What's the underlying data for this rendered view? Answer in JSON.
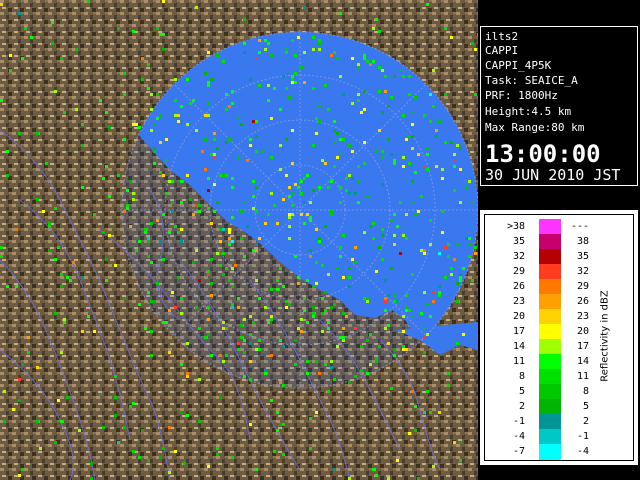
{
  "info": {
    "radar": "ilts2",
    "product": "CAPPI",
    "product_name": "CAPPI_4P5K",
    "task": "Task: SEAICE_A",
    "prf": "PRF: 1800Hz",
    "height": "Height:4.5 km",
    "max_range": "Max Range:80 km",
    "time": "13:00:00",
    "date": "30 JUN 2010 JST"
  },
  "legend": {
    "unit_label": "Reflectivity in dBZ",
    "entries": [
      {
        "lower": ">38",
        "upper": "---",
        "color": "#ff33ff"
      },
      {
        "lower": "35",
        "upper": "38",
        "color": "#c8006e"
      },
      {
        "lower": "32",
        "upper": "35",
        "color": "#b40000"
      },
      {
        "lower": "29",
        "upper": "32",
        "color": "#ff3c1e"
      },
      {
        "lower": "26",
        "upper": "29",
        "color": "#ff7800"
      },
      {
        "lower": "23",
        "upper": "26",
        "color": "#ffa000"
      },
      {
        "lower": "20",
        "upper": "23",
        "color": "#ffd200"
      },
      {
        "lower": "17",
        "upper": "20",
        "color": "#ffff00"
      },
      {
        "lower": "14",
        "upper": "17",
        "color": "#a0ff00"
      },
      {
        "lower": "11",
        "upper": "14",
        "color": "#00ff00"
      },
      {
        "lower": "8",
        "upper": "11",
        "color": "#00e000"
      },
      {
        "lower": "5",
        "upper": "8",
        "color": "#00c800"
      },
      {
        "lower": "2",
        "upper": "5",
        "color": "#00b400"
      },
      {
        "lower": "-1",
        "upper": "2",
        "color": "#009696"
      },
      {
        "lower": "-4",
        "upper": "-1",
        "color": "#00c8c8"
      },
      {
        "lower": "-7",
        "upper": "-4",
        "color": "#00ffff"
      }
    ]
  },
  "colors": {
    "sea": "#2c64e0",
    "radar_disc": "#3a78f0",
    "land": "#6b5a40",
    "rivers": "#6c6cd8",
    "range_rings": "#8c9ce0"
  }
}
